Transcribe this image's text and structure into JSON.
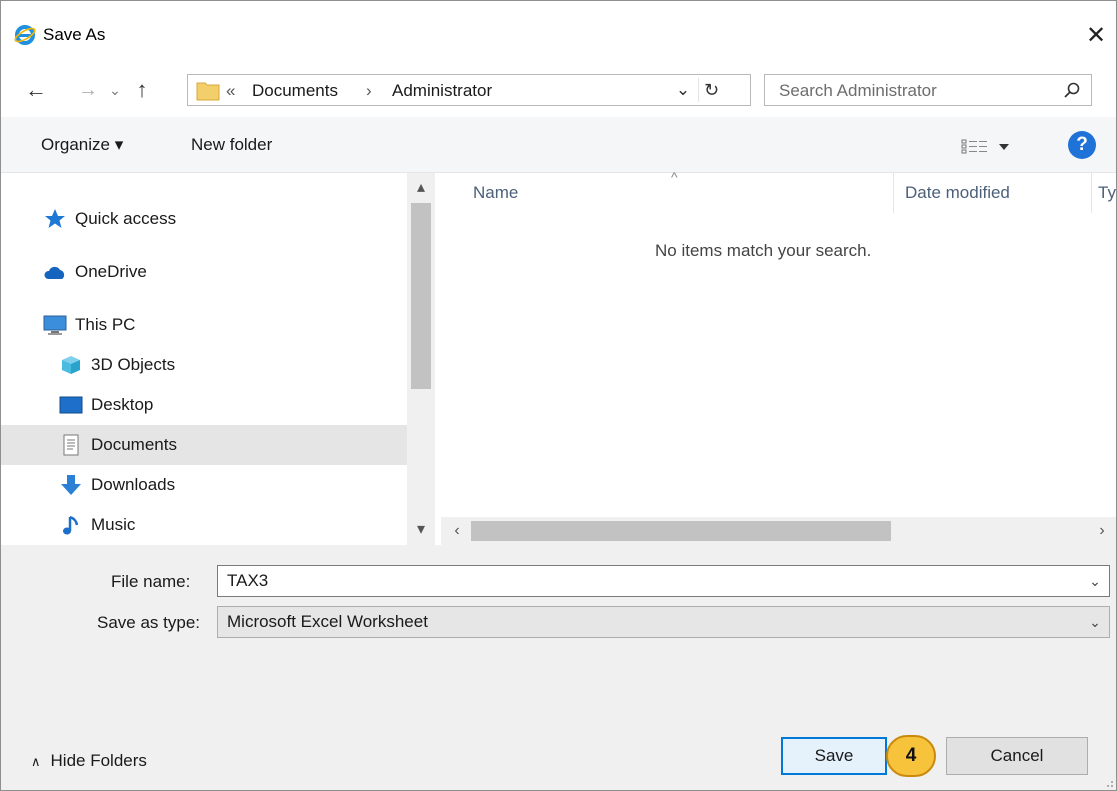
{
  "window": {
    "title": "Save As",
    "close_glyph": "✕"
  },
  "address_bar": {
    "back_glyph": "←",
    "forward_glyph": "→",
    "recent_glyph": "⌄",
    "up_glyph": "↑",
    "overflow": "«",
    "crumbs": [
      "Documents",
      "Administrator"
    ],
    "separator": "›",
    "dropdown_glyph": "⌄",
    "refresh_glyph": "↻"
  },
  "search": {
    "placeholder": "Search Administrator"
  },
  "toolbar": {
    "organize": "Organize ▾",
    "new_folder": "New folder",
    "help": "?"
  },
  "nav_pane": {
    "items": [
      {
        "label": "Quick access",
        "icon": "star-icon"
      },
      {
        "label": "OneDrive",
        "icon": "cloud-icon"
      },
      {
        "label": "This PC",
        "icon": "computer-icon"
      },
      {
        "label": "3D Objects",
        "icon": "cube-icon"
      },
      {
        "label": "Desktop",
        "icon": "desktop-icon"
      },
      {
        "label": "Documents",
        "icon": "document-icon",
        "selected": true
      },
      {
        "label": "Downloads",
        "icon": "download-arrow-icon"
      },
      {
        "label": "Music",
        "icon": "music-note-icon"
      }
    ]
  },
  "file_list": {
    "columns": [
      "Name",
      "Date modified",
      "Ty"
    ],
    "sort_glyph": "^",
    "empty_message": "No items match your search."
  },
  "form": {
    "file_name_label": "File name:",
    "file_name_value": "TAX3",
    "save_type_label": "Save as type:",
    "save_type_value": "Microsoft Excel Worksheet"
  },
  "footer": {
    "hide_folders": "Hide Folders",
    "save": "Save",
    "cancel": "Cancel",
    "step_badge": "4"
  },
  "colors": {
    "accent": "#0078d7",
    "badge": "#f6c33b",
    "help": "#1f73d8"
  }
}
